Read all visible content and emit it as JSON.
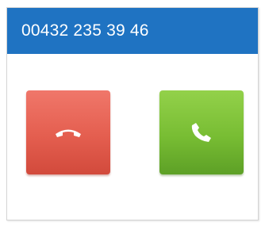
{
  "call": {
    "phone_number": "00432 235 39 46"
  },
  "buttons": {
    "reject_icon": "hang-up-icon",
    "accept_icon": "phone-icon"
  },
  "colors": {
    "header": "#1f73c2",
    "reject": "#e45e4f",
    "accept": "#78bd33"
  }
}
